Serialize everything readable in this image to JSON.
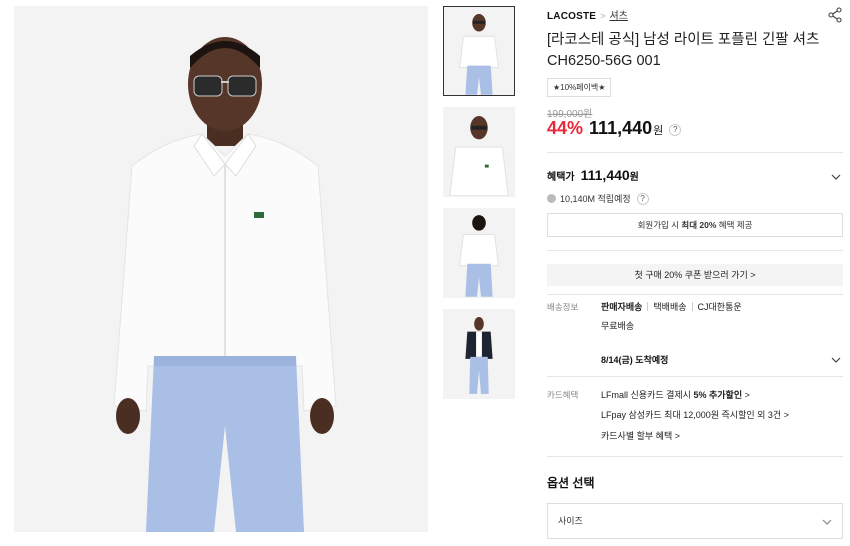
{
  "brand": "LACOSTE",
  "brand_separator": ">",
  "category": "셔츠",
  "title": "[라코스테 공식] 남성 라이트 포플린 긴팔 셔츠 CH6250-56G 001",
  "badge": "★10%페이백★",
  "price": {
    "original": "199,000원",
    "discount": "44%",
    "sale": "111,440",
    "currency": "원",
    "help": "?"
  },
  "benefit": {
    "label": "혜택가",
    "price": "111,440",
    "currency": "원",
    "points": "10,140M 적립예정",
    "points_help": "?"
  },
  "join_banner": {
    "pre": "회원가입 시 ",
    "bold": "최대 20%",
    "post": " 혜택 제공"
  },
  "coupon_banner": "첫 구매 20% 쿠폰 받으러 가기 >",
  "shipping": {
    "label": "배송정보",
    "seller": "판매자배송",
    "method": "택배배송",
    "carrier": "CJ대한통운",
    "fee": "무료배송",
    "arrival": "8/14(금) 도착예정"
  },
  "card": {
    "label": "카드혜택",
    "lines": [
      {
        "pre": "LFmall 신용카드 결제시 ",
        "bold": "5% 추가할인",
        "post": " >"
      },
      {
        "pre": "LFpay 삼성카드 최대 12,000원 즉시할인 외 3건",
        "bold": "",
        "post": " >"
      },
      {
        "pre": "카드사별 할부 혜택",
        "bold": "",
        "post": " >"
      }
    ]
  },
  "options": {
    "title": "옵션 선택",
    "size_placeholder": "사이즈"
  },
  "icons": [
    "share-icon",
    "chevron-down-icon",
    "m-point-icon"
  ],
  "colors": {
    "discount": "#e8293b",
    "shirt": "#ffffff",
    "pants": "#a9bfe6",
    "background": "#f3f3f3"
  }
}
